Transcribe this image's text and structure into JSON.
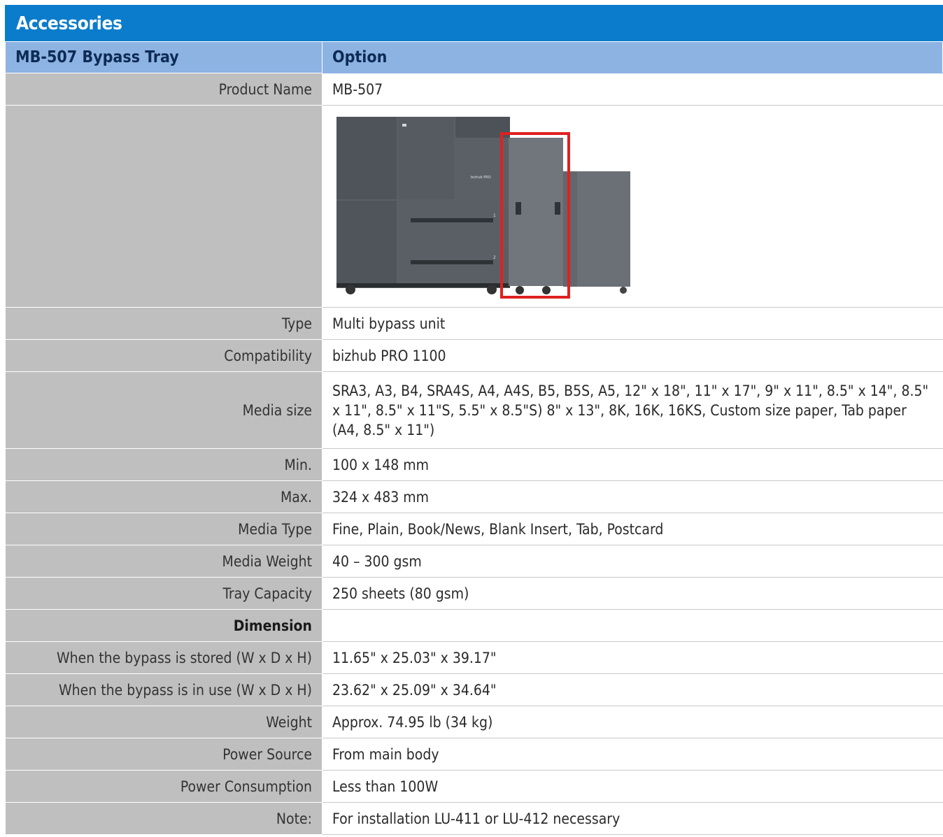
{
  "section_title": "Accessories",
  "header": {
    "product_label": "MB-507  Bypass Tray",
    "option_label": "Option"
  },
  "rows": [
    {
      "label": "Product Name",
      "value": "MB-507"
    },
    {
      "label": "Type",
      "value": "Multi bypass unit"
    },
    {
      "label": "Compatibility",
      "value": "bizhub PRO 1100"
    },
    {
      "label": "Media size",
      "value": "SRA3, A3, B4, SRA4S, A4, A4S, B5, B5S, A5, 12\" x 18\", 11\" x 17\", 9\" x 11\", 8.5\" x 14\", 8.5\" x 11\", 8.5\" x 11\"S, 5.5\" x 8.5\"S) 8\" x 13\", 8K, 16K, 16KS, Custom size paper, Tab paper (A4, 8.5\" x 11\")"
    },
    {
      "label": "Min.",
      "value": "100 x 148 mm"
    },
    {
      "label": "Max.",
      "value": "324 x 483 mm"
    },
    {
      "label": "Media Type",
      "value": "Fine, Plain, Book/News, Blank Insert, Tab, Postcard"
    },
    {
      "label": "Media Weight",
      "value": "40 – 300 gsm"
    },
    {
      "label": "Tray Capacity",
      "value": "250 sheets (80 gsm)"
    },
    {
      "label": "Dimension",
      "value": ""
    },
    {
      "label": "When the bypass is stored (W x D x H)",
      "value": "11.65\" x 25.03\" x 39.17\""
    },
    {
      "label": "When the bypass is in use (W x D x H)",
      "value": "23.62\" x 25.09\" x 34.64\""
    },
    {
      "label": "Weight",
      "value": "Approx. 74.95 lb (34 kg)"
    },
    {
      "label": "Power Source",
      "value": "From main body"
    },
    {
      "label": "Power Consumption",
      "value": "Less than 100W"
    },
    {
      "label": "Note:",
      "value": "For installation LU-411 or LU-412 necessary"
    }
  ],
  "image": {
    "description_icon": "printer-with-bypass-unit-illustration",
    "tray_label_1": "1",
    "tray_label_2": "2",
    "brand_text": "bizhub PRO",
    "highlight_color": "#e02020"
  }
}
